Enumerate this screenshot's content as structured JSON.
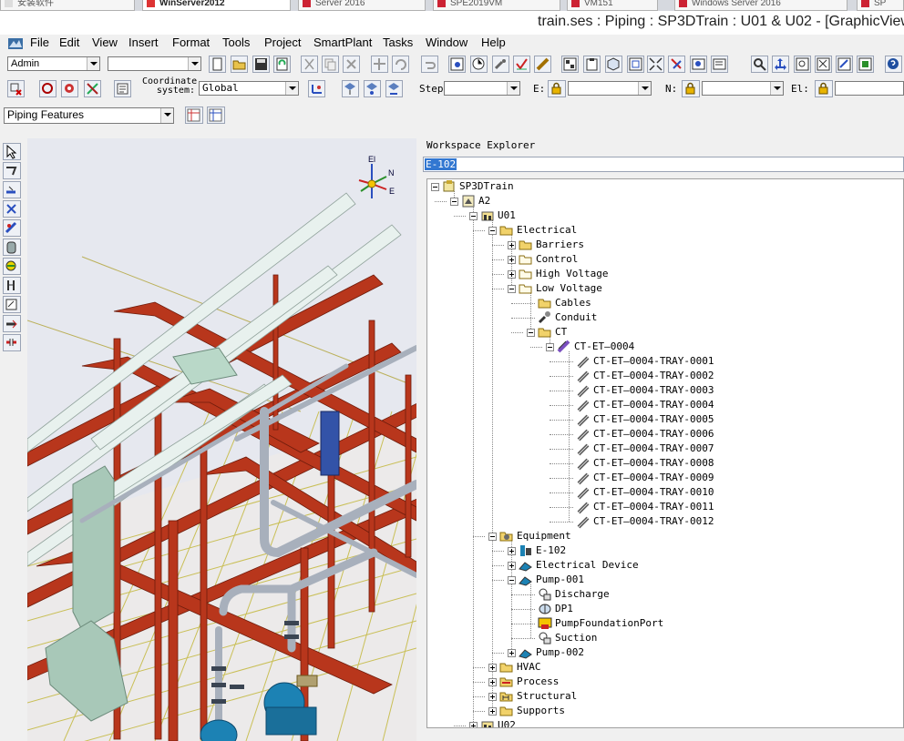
{
  "host_tabs": [
    "安装软件",
    "WinServer2012",
    "Server 2016",
    "SPE2019VM",
    "VM151",
    "Windows Server 2016",
    "SP"
  ],
  "window": {
    "title": "train.ses : Piping : SP3DTrain : U01 & U02 - [GraphicView"
  },
  "menu": [
    "File",
    "Edit",
    "View",
    "Insert",
    "Format",
    "Tools",
    "Project",
    "SmartPlant",
    "Tasks",
    "Window",
    "Help"
  ],
  "toolbar": {
    "permission_group": "Admin",
    "second_combo": "",
    "coordinate_label": "Coordinate\nsystem:",
    "coordinate_system": "Global",
    "step_label": "Step:",
    "e_label": "E:",
    "n_label": "N:",
    "el_label": "El:",
    "task_features": "Piping Features"
  },
  "explorer": {
    "title": "Workspace Explorer",
    "search_value": "E-102",
    "tree": [
      {
        "label": "SP3DTrain",
        "depth": 0,
        "expander": "open",
        "icon": "model-icon"
      },
      {
        "label": "A2",
        "depth": 1,
        "expander": "open",
        "icon": "area-icon"
      },
      {
        "label": "U01",
        "depth": 2,
        "expander": "open",
        "icon": "unit-icon"
      },
      {
        "label": "Electrical",
        "depth": 3,
        "expander": "open",
        "icon": "folder-icon"
      },
      {
        "label": "Barriers",
        "depth": 4,
        "expander": "closed",
        "icon": "folder-icon"
      },
      {
        "label": "Control",
        "depth": 4,
        "expander": "closed",
        "icon": "folder-white-icon"
      },
      {
        "label": "High Voltage",
        "depth": 4,
        "expander": "closed",
        "icon": "folder-white-icon"
      },
      {
        "label": "Low Voltage",
        "depth": 4,
        "expander": "open",
        "icon": "folder-white-icon"
      },
      {
        "label": "Cables",
        "depth": 5,
        "expander": "none",
        "icon": "folder-icon"
      },
      {
        "label": "Conduit",
        "depth": 5,
        "expander": "none",
        "icon": "conduit-icon"
      },
      {
        "label": "CT",
        "depth": 5,
        "expander": "open",
        "icon": "folder-icon"
      },
      {
        "label": "CT-ET—0004",
        "depth": 6,
        "expander": "open",
        "icon": "cable-tray-run-icon"
      },
      {
        "label": "CT-ET—0004-TRAY-0001",
        "depth": 7,
        "expander": "none",
        "icon": "tray-icon"
      },
      {
        "label": "CT-ET—0004-TRAY-0002",
        "depth": 7,
        "expander": "none",
        "icon": "tray-icon"
      },
      {
        "label": "CT-ET—0004-TRAY-0003",
        "depth": 7,
        "expander": "none",
        "icon": "tray-icon"
      },
      {
        "label": "CT-ET—0004-TRAY-0004",
        "depth": 7,
        "expander": "none",
        "icon": "tray-icon"
      },
      {
        "label": "CT-ET—0004-TRAY-0005",
        "depth": 7,
        "expander": "none",
        "icon": "tray-icon"
      },
      {
        "label": "CT-ET—0004-TRAY-0006",
        "depth": 7,
        "expander": "none",
        "icon": "tray-icon"
      },
      {
        "label": "CT-ET—0004-TRAY-0007",
        "depth": 7,
        "expander": "none",
        "icon": "tray-icon"
      },
      {
        "label": "CT-ET—0004-TRAY-0008",
        "depth": 7,
        "expander": "none",
        "icon": "tray-icon"
      },
      {
        "label": "CT-ET—0004-TRAY-0009",
        "depth": 7,
        "expander": "none",
        "icon": "tray-icon"
      },
      {
        "label": "CT-ET—0004-TRAY-0010",
        "depth": 7,
        "expander": "none",
        "icon": "tray-icon"
      },
      {
        "label": "CT-ET—0004-TRAY-0011",
        "depth": 7,
        "expander": "none",
        "icon": "tray-icon"
      },
      {
        "label": "CT-ET—0004-TRAY-0012",
        "depth": 7,
        "expander": "none",
        "icon": "tray-icon"
      },
      {
        "label": "Equipment",
        "depth": 3,
        "expander": "open",
        "icon": "equipment-folder-icon"
      },
      {
        "label": "E-102",
        "depth": 4,
        "expander": "closed",
        "icon": "exchanger-icon"
      },
      {
        "label": "Electrical Device",
        "depth": 4,
        "expander": "closed",
        "icon": "equipment-icon"
      },
      {
        "label": "Pump-001",
        "depth": 4,
        "expander": "open",
        "icon": "pump-icon"
      },
      {
        "label": "Discharge",
        "depth": 5,
        "expander": "none",
        "icon": "nozzle-icon"
      },
      {
        "label": "DP1",
        "depth": 5,
        "expander": "none",
        "icon": "datum-icon"
      },
      {
        "label": "PumpFoundationPort",
        "depth": 5,
        "expander": "none",
        "icon": "foundation-port-icon"
      },
      {
        "label": "Suction",
        "depth": 5,
        "expander": "none",
        "icon": "nozzle-icon"
      },
      {
        "label": "Pump-002",
        "depth": 4,
        "expander": "closed",
        "icon": "pump-icon"
      },
      {
        "label": "HVAC",
        "depth": 3,
        "expander": "closed",
        "icon": "folder-icon"
      },
      {
        "label": "Process",
        "depth": 3,
        "expander": "closed",
        "icon": "process-folder-icon"
      },
      {
        "label": "Structural",
        "depth": 3,
        "expander": "closed",
        "icon": "structural-folder-icon"
      },
      {
        "label": "Supports",
        "depth": 3,
        "expander": "closed",
        "icon": "folder-icon"
      },
      {
        "label": "U02",
        "depth": 2,
        "expander": "closed",
        "icon": "unit-icon"
      }
    ]
  },
  "compass": {
    "up": "El",
    "north": "N",
    "east": "E"
  },
  "colors": {
    "steel": "#b8361c",
    "tray": "#e8f1ee",
    "duct": "#a8c8b8",
    "pipe": "#a8b0bc",
    "pump": "#1c82b4",
    "selection": "#3277d1"
  }
}
